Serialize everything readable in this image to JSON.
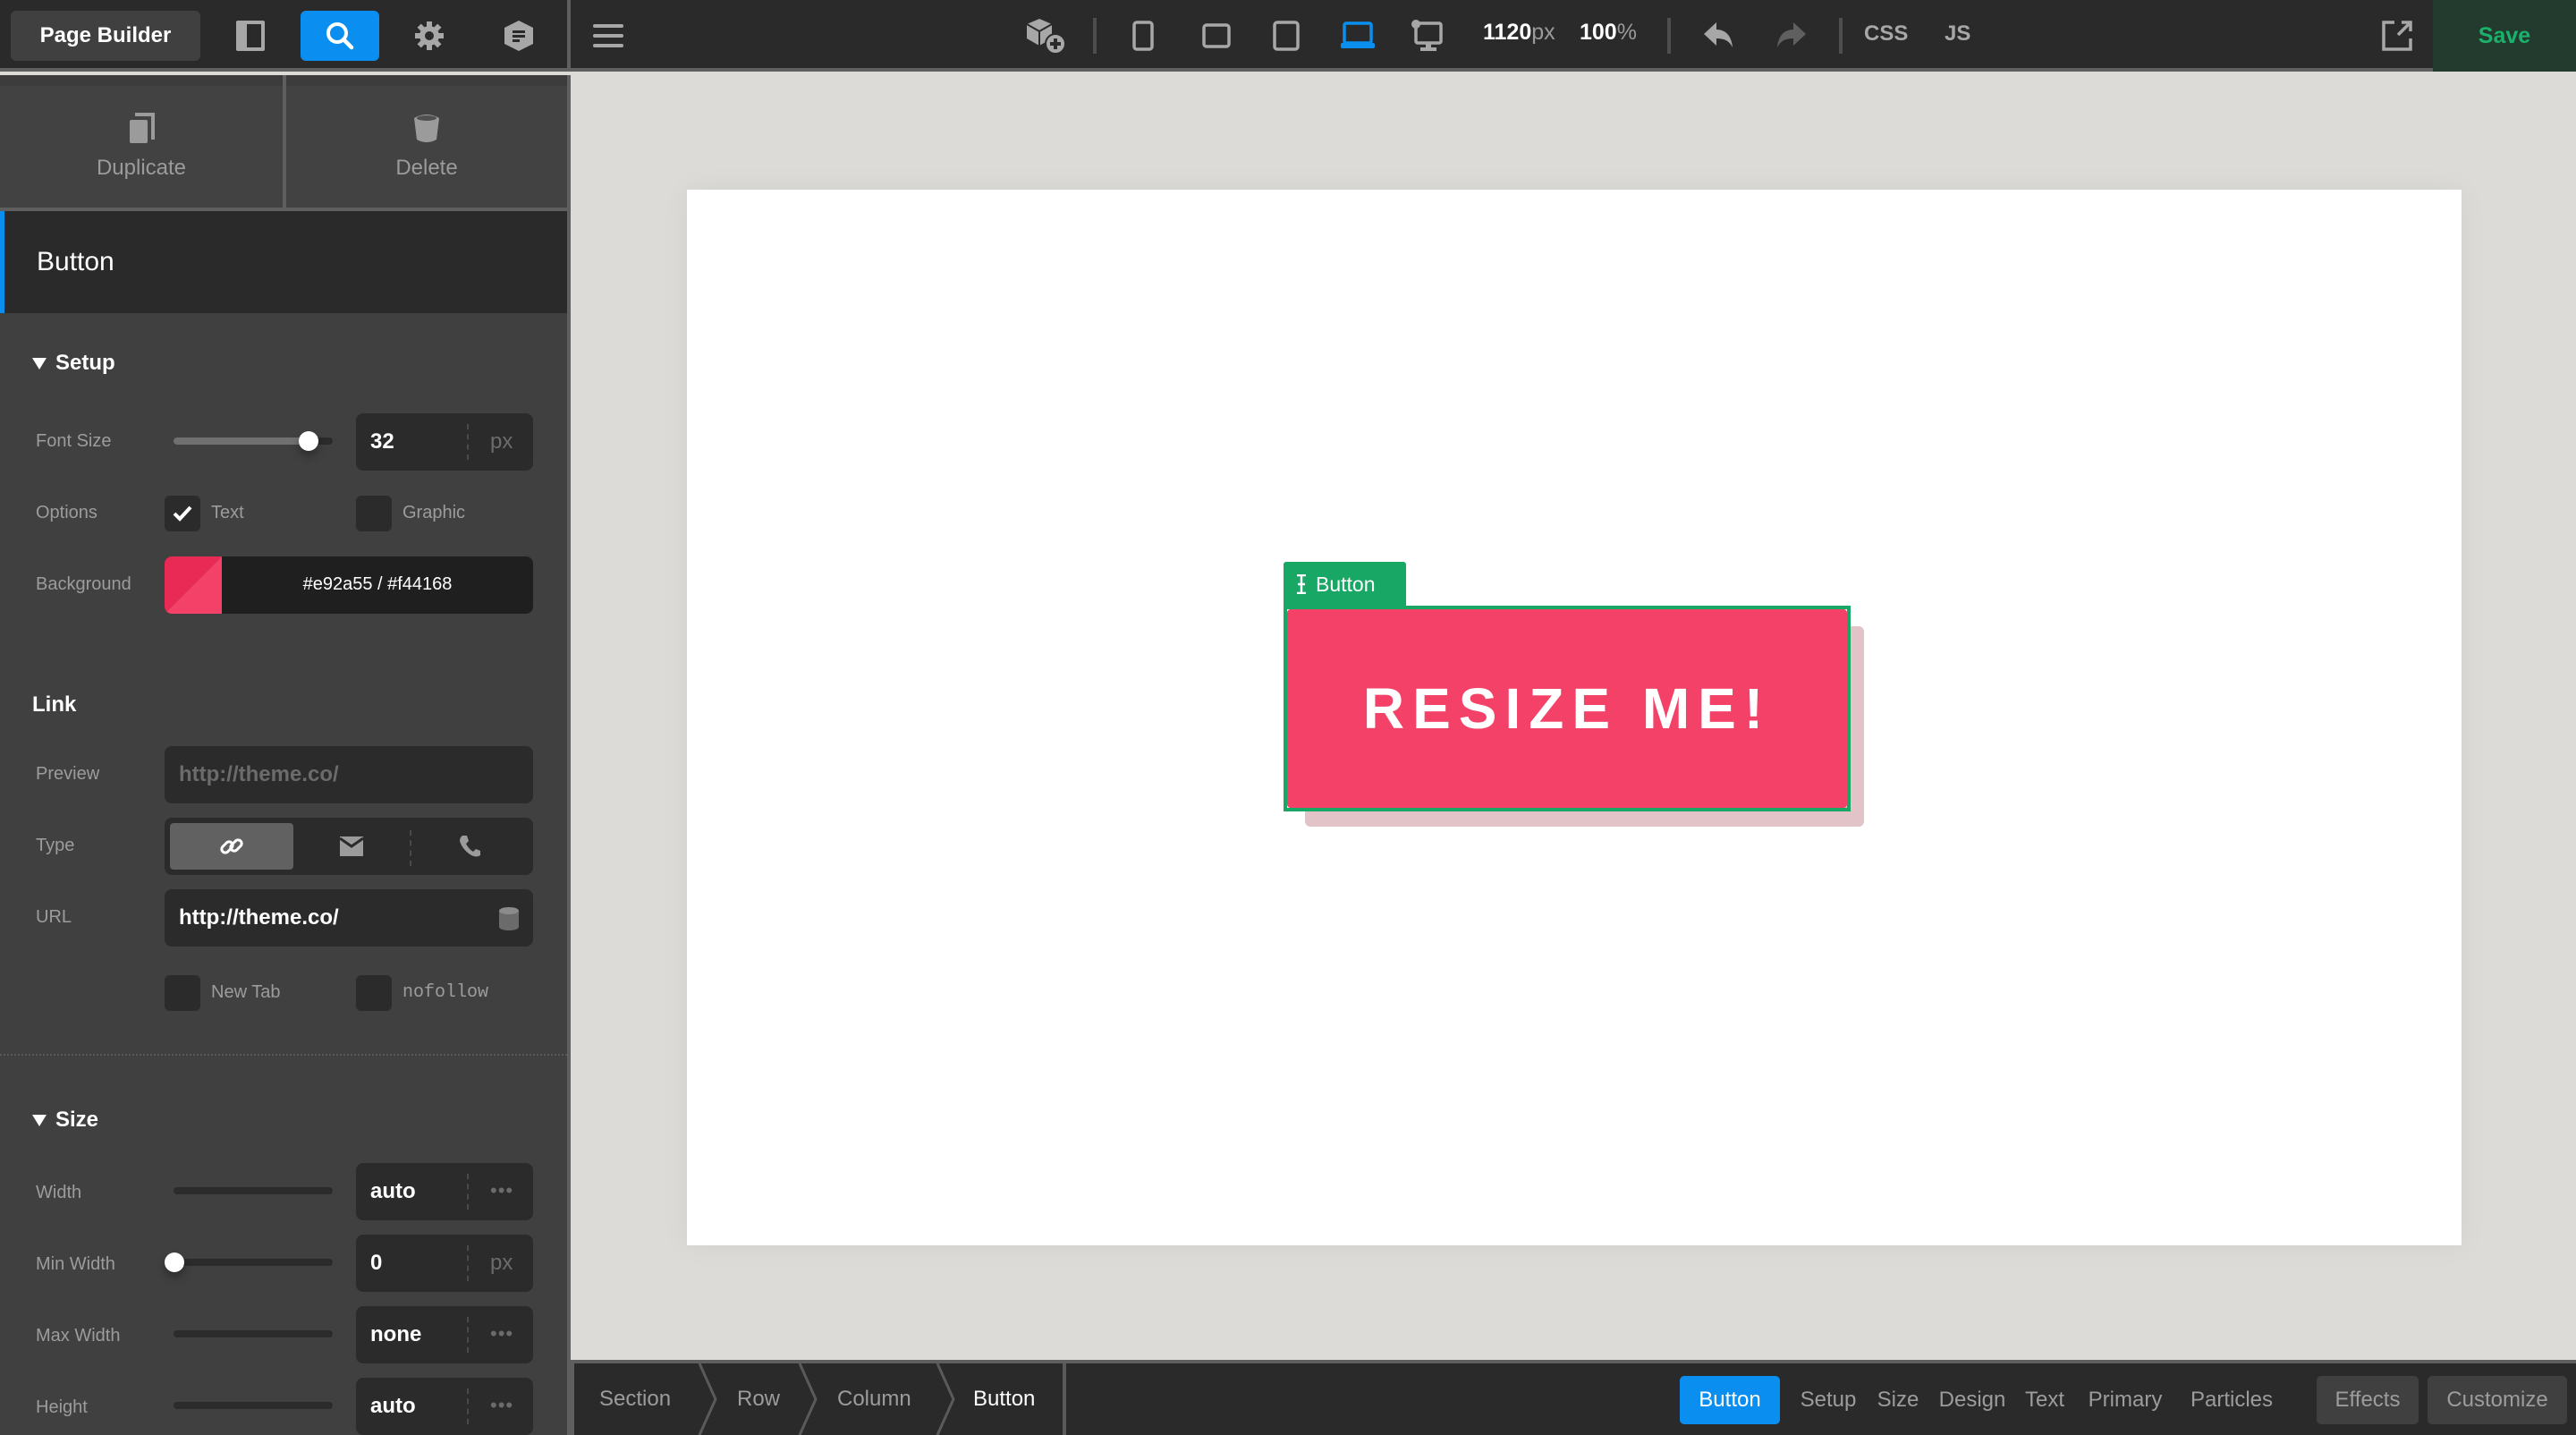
{
  "topbar": {
    "app_label": "Page Builder",
    "rail_icons": [
      "layout-icon",
      "search-icon",
      "gear-icon",
      "document-icon"
    ],
    "active_rail_icon": "search-icon",
    "device_icons": [
      "phone-icon",
      "phone-landscape-icon",
      "tablet-icon",
      "laptop-icon",
      "desktop-icon"
    ],
    "active_device": "laptop-icon",
    "width_value": "1120",
    "width_unit": "px",
    "zoom_value": "100",
    "zoom_unit": "%",
    "css_label": "CSS",
    "js_label": "JS",
    "save_label": "Save",
    "colors": {
      "accent": "#0a8ff0",
      "save": "#1ab26b"
    }
  },
  "panel": {
    "actions": {
      "duplicate": "Duplicate",
      "delete": "Delete"
    },
    "element_title": "Button",
    "setup": {
      "title": "Setup",
      "font_size_label": "Font Size",
      "font_size_value": "32",
      "font_size_unit": "px",
      "font_size_slider_fraction": 0.85,
      "options_label": "Options",
      "option_text": "Text",
      "option_text_checked": true,
      "option_graphic": "Graphic",
      "option_graphic_checked": false,
      "background_label": "Background",
      "background_value": "#e92a55 / #f44168",
      "background_colors": [
        "#e92a55",
        "#f44168"
      ]
    },
    "link": {
      "title": "Link",
      "preview_label": "Preview",
      "preview_placeholder": "http://theme.co/",
      "type_label": "Type",
      "type_options": [
        "link-icon",
        "mail-icon",
        "phone-icon"
      ],
      "type_selected": "link-icon",
      "url_label": "URL",
      "url_value": "http://theme.co/",
      "new_tab_label": "New Tab",
      "nofollow_label": "nofollow"
    },
    "size": {
      "title": "Size",
      "width_label": "Width",
      "width_value": "auto",
      "min_width_label": "Min Width",
      "min_width_value": "0",
      "min_width_unit": "px",
      "min_width_slider_fraction": 0,
      "max_width_label": "Max Width",
      "max_width_value": "none",
      "height_label": "Height",
      "height_value": "auto",
      "more_label": "•••"
    }
  },
  "canvas": {
    "element_tag": "Button",
    "button_text": "RESIZE ME!",
    "button_color": "#f44168",
    "outline_color": "#18a764"
  },
  "bottombar": {
    "breadcrumbs": [
      "Section",
      "Row",
      "Column",
      "Button"
    ],
    "controls": [
      "Button",
      "Setup",
      "Size",
      "Design",
      "Text",
      "Primary",
      "Particles",
      "Effects",
      "Customize"
    ],
    "active_control": "Button"
  }
}
